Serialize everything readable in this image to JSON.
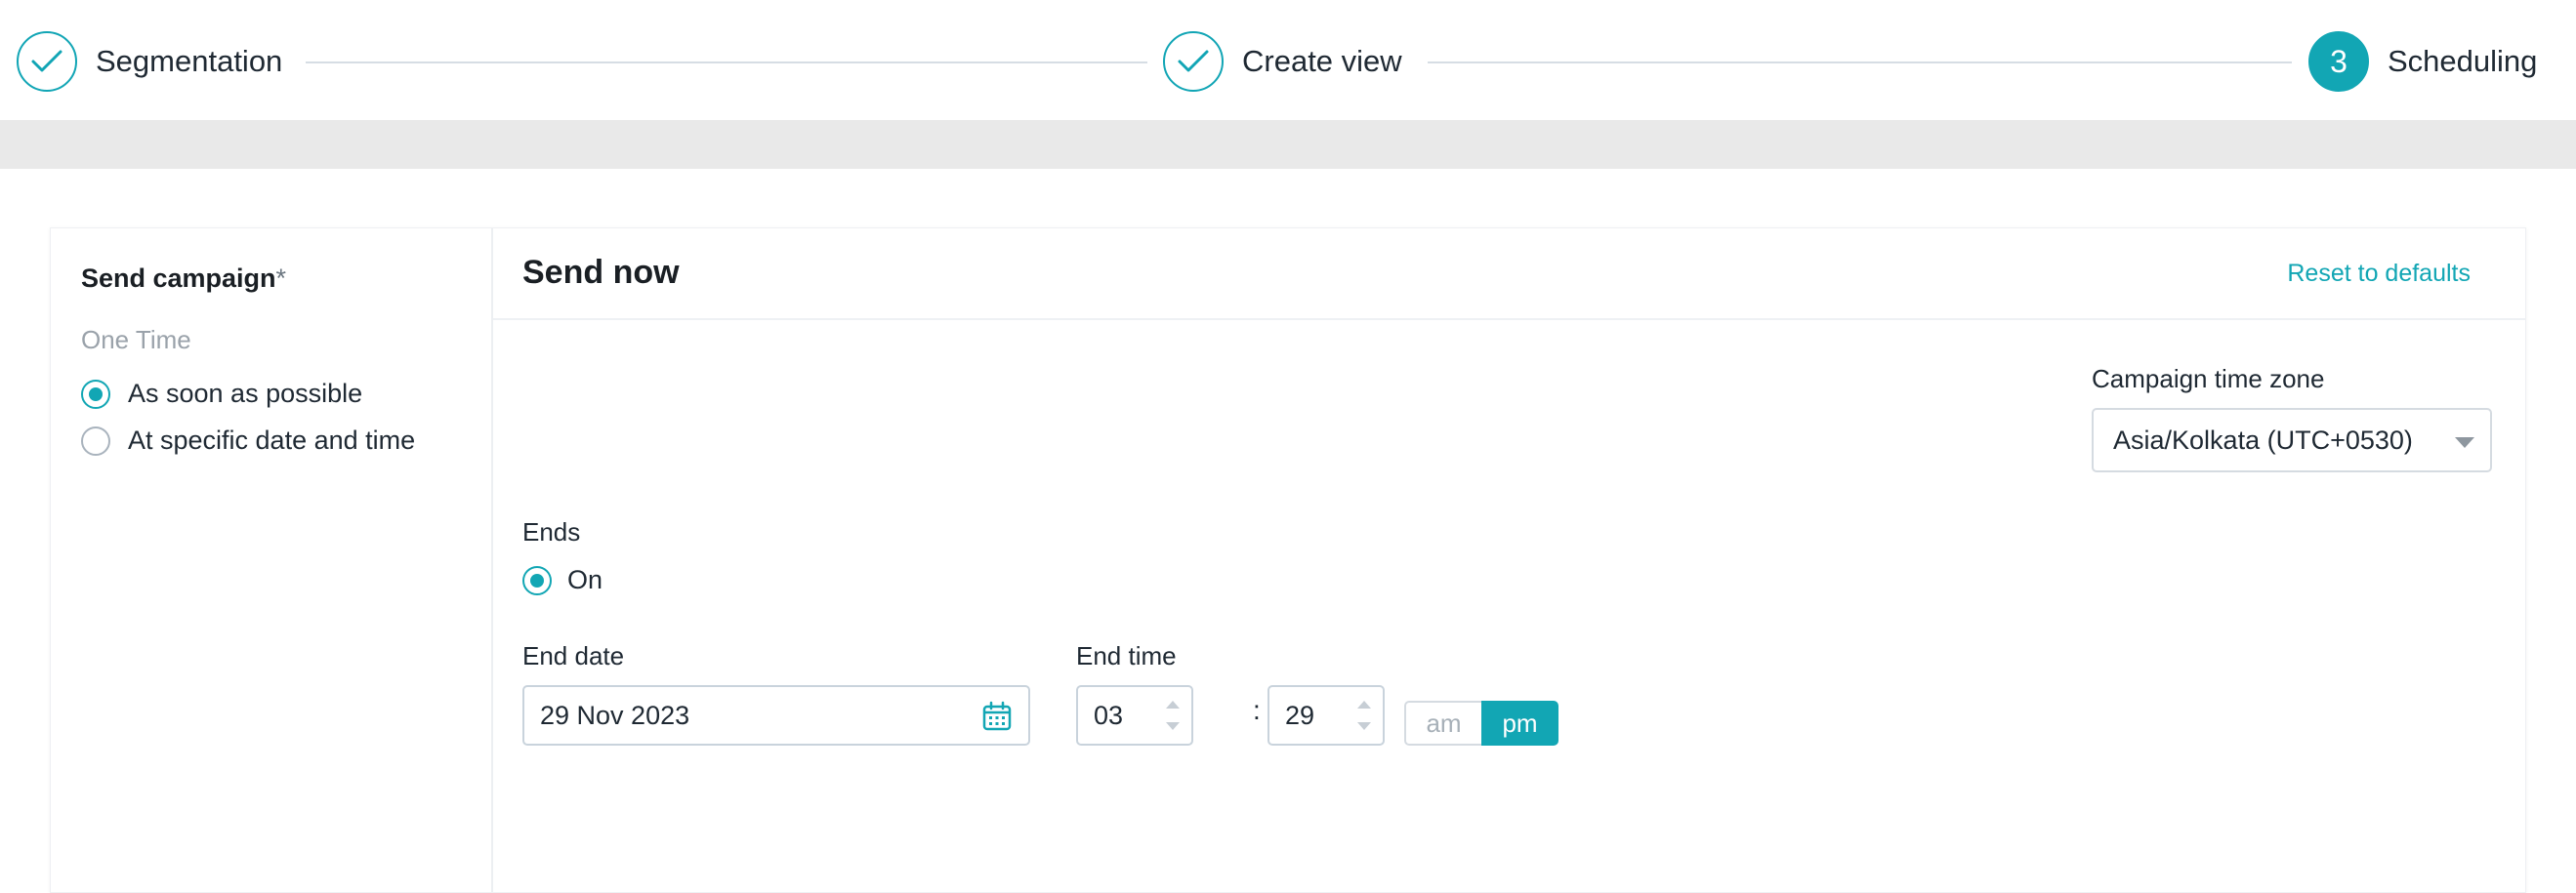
{
  "stepper": {
    "steps": [
      {
        "label": "Segmentation",
        "state": "complete"
      },
      {
        "label": "Create view",
        "state": "complete"
      },
      {
        "label": "Scheduling",
        "state": "active",
        "number": "3"
      }
    ]
  },
  "left": {
    "title": "Send campaign",
    "required_mark": "*",
    "section": "One Time",
    "options": [
      {
        "label": "As soon as possible",
        "checked": true
      },
      {
        "label": "At specific date and time",
        "checked": false
      }
    ]
  },
  "right": {
    "title": "Send now",
    "reset_label": "Reset to defaults",
    "timezone_label": "Campaign time zone",
    "timezone_value": "Asia/Kolkata (UTC+0530)",
    "ends_label": "Ends",
    "ends_option": "On",
    "end_date_label": "End date",
    "end_date_value": "29 Nov 2023",
    "end_time_label": "End time",
    "hour": "03",
    "minute": "29",
    "separator": ":",
    "am_label": "am",
    "pm_label": "pm",
    "selected_period": "pm"
  },
  "colors": {
    "accent": "#12a6b4",
    "band": "#e9e9e9"
  }
}
